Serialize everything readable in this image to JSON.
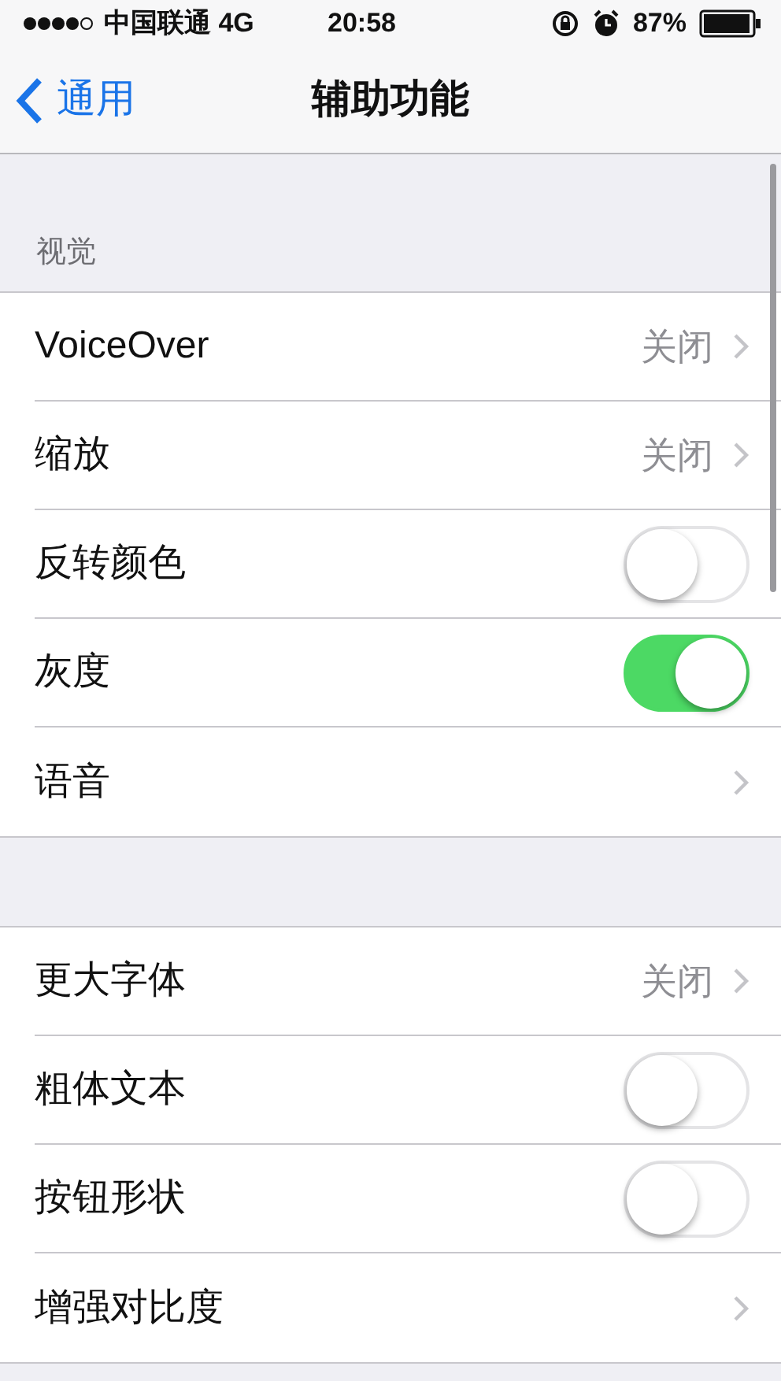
{
  "status_bar": {
    "carrier": "中国联通 4G",
    "time": "20:58",
    "battery_percent": "87%"
  },
  "nav": {
    "back": "通用",
    "title": "辅助功能"
  },
  "sections": [
    {
      "header": "视觉",
      "rows": [
        {
          "kind": "detail",
          "label": "VoiceOver",
          "value": "关闭"
        },
        {
          "kind": "detail",
          "label": "缩放",
          "value": "关闭"
        },
        {
          "kind": "toggle",
          "label": "反转颜色",
          "on": false
        },
        {
          "kind": "toggle",
          "label": "灰度",
          "on": true
        },
        {
          "kind": "link",
          "label": "语音"
        }
      ]
    },
    {
      "rows": [
        {
          "kind": "detail",
          "label": "更大字体",
          "value": "关闭"
        },
        {
          "kind": "toggle",
          "label": "粗体文本",
          "on": false
        },
        {
          "kind": "toggle",
          "label": "按钮形状",
          "on": false
        },
        {
          "kind": "link",
          "label": "增强对比度"
        }
      ]
    }
  ]
}
